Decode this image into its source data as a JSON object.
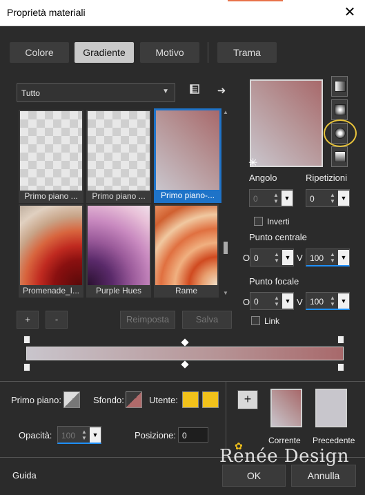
{
  "window": {
    "title": "Proprietà materiali",
    "accent": "#e8734a"
  },
  "tabs": [
    {
      "label": "Colore",
      "active": false
    },
    {
      "label": "Gradiente",
      "active": true
    },
    {
      "label": "Motivo",
      "active": false
    },
    {
      "label": "Trama",
      "active": false
    }
  ],
  "library": {
    "filter": "Tutto",
    "items": [
      {
        "caption": "Primo piano ...",
        "selected": false
      },
      {
        "caption": "Primo piano ...",
        "selected": false
      },
      {
        "caption": "Primo piano-...",
        "selected": true
      },
      {
        "caption": "Promenade_I...",
        "selected": false
      },
      {
        "caption": "Purple Hues",
        "selected": false
      },
      {
        "caption": "Rame",
        "selected": false
      }
    ],
    "add_label": "+",
    "remove_label": "-",
    "reset_label": "Reimposta",
    "save_label": "Salva"
  },
  "settings": {
    "angle_label": "Angolo",
    "angle_value": "0",
    "repeat_label": "Ripetizioni",
    "repeat_value": "0",
    "invert_label": "Inverti",
    "center_label": "Punto centrale",
    "center_o_label": "O",
    "center_o_value": "0",
    "center_v_label": "V",
    "center_v_value": "100",
    "focus_label": "Punto focale",
    "focus_o_label": "O",
    "focus_o_value": "0",
    "focus_v_label": "V",
    "focus_v_value": "100",
    "link_label": "Link"
  },
  "bottom": {
    "foreground_label": "Primo piano:",
    "background_label": "Sfondo:",
    "user_label": "Utente:",
    "user_color": "#f2c21b",
    "opacity_label": "Opacità:",
    "opacity_value": "100",
    "position_label": "Posizione:",
    "position_value": "0",
    "add_label": "+",
    "current_label": "Corrente",
    "previous_label": "Precedente"
  },
  "footer": {
    "help_label": "Guida",
    "ok_label": "OK",
    "cancel_label": "Annulla",
    "watermark": "Renée Design"
  }
}
